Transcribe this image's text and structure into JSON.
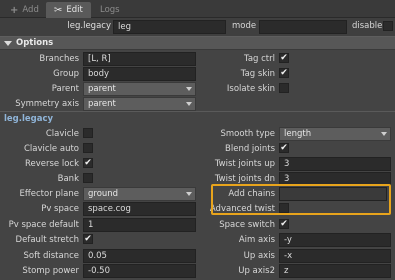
{
  "tabs": [
    {
      "label": "Add",
      "icon": "plus-icon"
    },
    {
      "label": "Edit",
      "icon": "scissors-icon"
    },
    {
      "label": "Logs"
    }
  ],
  "header": {
    "name_label": "leg.legacy",
    "name_value": "leg",
    "mode_label": "mode",
    "mode_value": "",
    "disable_label": "disable"
  },
  "section_title": "Options",
  "options": {
    "branches_label": "Branches",
    "branches_value": "[L, R]",
    "group_label": "Group",
    "group_value": "body",
    "parent_label": "Parent",
    "parent_value": "parent",
    "symmetry_axis_label": "Symmetry axis",
    "symmetry_axis_value": "parent",
    "tag_ctrl_label": "Tag ctrl",
    "tag_ctrl_checked": true,
    "tag_skin_label": "Tag skin",
    "tag_skin_checked": true,
    "isolate_skin_label": "Isolate skin",
    "isolate_skin_checked": false
  },
  "legacy_title": "leg.legacy",
  "legacy": {
    "clavicle_label": "Clavicle",
    "clavicle_checked": false,
    "clavicle_auto_label": "Clavicle auto",
    "clavicle_auto_checked": false,
    "reverse_lock_label": "Reverse lock",
    "reverse_lock_checked": true,
    "bank_label": "Bank",
    "bank_checked": false,
    "effector_plane_label": "Effector plane",
    "effector_plane_value": "ground",
    "pv_space_label": "Pv space",
    "pv_space_value": "space.cog",
    "pv_space_default_label": "Pv space default",
    "pv_space_default_value": "1",
    "default_stretch_label": "Default stretch",
    "default_stretch_checked": true,
    "soft_distance_label": "Soft distance",
    "soft_distance_value": "0.05",
    "stomp_power_label": "Stomp power",
    "stomp_power_value": "-0.50",
    "smooth_type_label": "Smooth type",
    "smooth_type_value": "length",
    "blend_joints_label": "Blend joints",
    "blend_joints_checked": true,
    "twist_joints_up_label": "Twist joints up",
    "twist_joints_up_value": "3",
    "twist_joints_dn_label": "Twist joints dn",
    "twist_joints_dn_value": "3",
    "add_chains_label": "Add chains",
    "add_chains_value": "",
    "advanced_twist_label": "Advanced twist",
    "advanced_twist_checked": false,
    "space_switch_label": "Space switch",
    "space_switch_checked": true,
    "aim_axis_label": "Aim axis",
    "aim_axis_value": "-y",
    "up_axis_label": "Up axis",
    "up_axis_value": "-x",
    "up_axis2_label": "Up axis2",
    "up_axis2_value": "z"
  },
  "colors": {
    "highlight": "#e8a41c",
    "subsection": "#8fb4d8"
  }
}
